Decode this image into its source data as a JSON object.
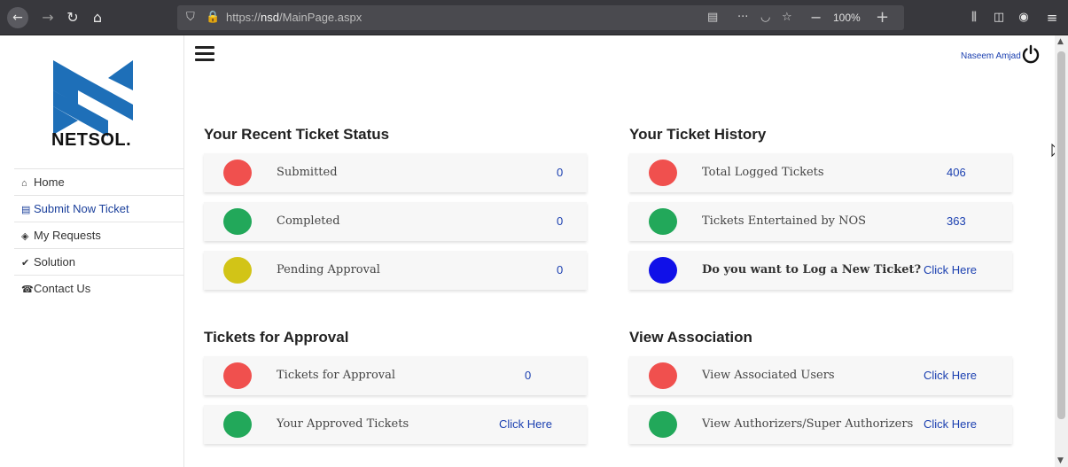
{
  "browser": {
    "url_prefix": "https://",
    "url_host": "nsd",
    "url_path": "/MainPage.aspx",
    "zoom": "100%"
  },
  "sidebar": {
    "logo_text": "NETSOL.",
    "items": [
      {
        "label": "Home",
        "icon": "home-icon"
      },
      {
        "label": "Submit Now Ticket",
        "icon": "file-icon"
      },
      {
        "label": "My Requests",
        "icon": "tag-icon"
      },
      {
        "label": "Solution",
        "icon": "check-icon"
      },
      {
        "label": "Contact Us",
        "icon": "phone-icon"
      }
    ]
  },
  "header": {
    "user_name": "Naseem Amjad"
  },
  "recent_status": {
    "title": "Your Recent Ticket Status",
    "rows": [
      {
        "label": "Submitted",
        "value": "0",
        "color": "#f0504e"
      },
      {
        "label": "Completed",
        "value": "0",
        "color": "#22a85a"
      },
      {
        "label": "Pending Approval",
        "value": "0",
        "color": "#d2c417"
      }
    ]
  },
  "history": {
    "title": "Your Ticket History",
    "rows": [
      {
        "label": "Total Logged Tickets",
        "value": "406",
        "color": "#f0504e"
      },
      {
        "label": "Tickets Entertained by NOS",
        "value": "363",
        "color": "#22a85a"
      },
      {
        "label": "Do you want to Log a New Ticket?",
        "value": "Click Here",
        "color": "#1010e8"
      }
    ]
  },
  "approval": {
    "title": "Tickets for Approval",
    "rows": [
      {
        "label": "Tickets for Approval",
        "value": "0",
        "color": "#f0504e"
      },
      {
        "label": "Your Approved Tickets",
        "value": "Click Here",
        "color": "#22a85a"
      }
    ]
  },
  "association": {
    "title": "View Association",
    "rows": [
      {
        "label": "View Associated Users",
        "value": "Click Here",
        "color": "#f0504e"
      },
      {
        "label": "View Authorizers/Super Authorizers",
        "value": "Click Here",
        "color": "#22a85a"
      }
    ]
  }
}
